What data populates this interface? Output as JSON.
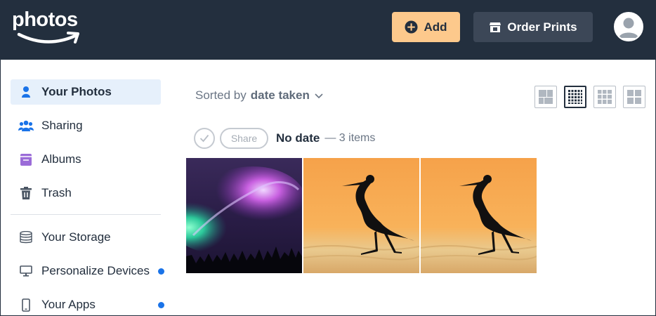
{
  "header": {
    "logo_text": "photos",
    "add_label": "Add",
    "order_prints_label": "Order Prints"
  },
  "sidebar": {
    "items": [
      {
        "label": "Your Photos",
        "icon": "person-icon",
        "active": true
      },
      {
        "label": "Sharing",
        "icon": "people-icon"
      },
      {
        "label": "Albums",
        "icon": "album-icon"
      },
      {
        "label": "Trash",
        "icon": "trash-icon"
      },
      {
        "label": "Your Storage",
        "icon": "database-icon"
      },
      {
        "label": "Personalize Devices",
        "icon": "monitor-icon",
        "notification_dot": true
      },
      {
        "label": "Your Apps",
        "icon": "phone-icon",
        "notification_dot": true
      }
    ]
  },
  "main": {
    "sort_prefix": "Sorted by",
    "sort_value": "date taken",
    "group": {
      "share_label": "Share",
      "title": "No date",
      "count_text": "— 3 items"
    },
    "photos": [
      {
        "subject": "aurora borealis over tree silhouettes"
      },
      {
        "subject": "heron silhouette at sunset"
      },
      {
        "subject": "heron silhouette at sunset"
      }
    ]
  },
  "colors": {
    "header_bg": "#232f3e",
    "add_button": "#fdc98c",
    "order_button": "#3c4757",
    "active_nav_bg": "#e6f0fb",
    "accent_blue": "#1a73e8",
    "albums_purple": "#9b6cd8"
  }
}
